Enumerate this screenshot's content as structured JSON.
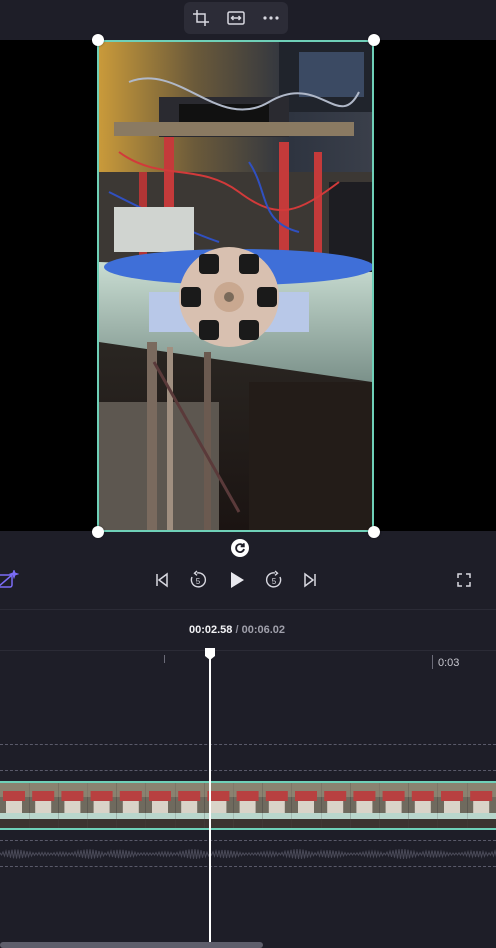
{
  "toolbar": {
    "buttons": [
      {
        "icon": "crop-icon"
      },
      {
        "icon": "fit-width-icon"
      },
      {
        "icon": "more-icon",
        "glyph": "···"
      }
    ]
  },
  "player": {
    "current_time": "00:02.58",
    "separator": "/",
    "duration": "00:06.02"
  },
  "timeline": {
    "tick_label": "0:03"
  },
  "colors": {
    "background": "#1e1e28",
    "accent": "#6fd0b8",
    "toolbar": "#2c2c37",
    "playhead": "#ffffff",
    "ai_icon": "#7b6cf6"
  }
}
